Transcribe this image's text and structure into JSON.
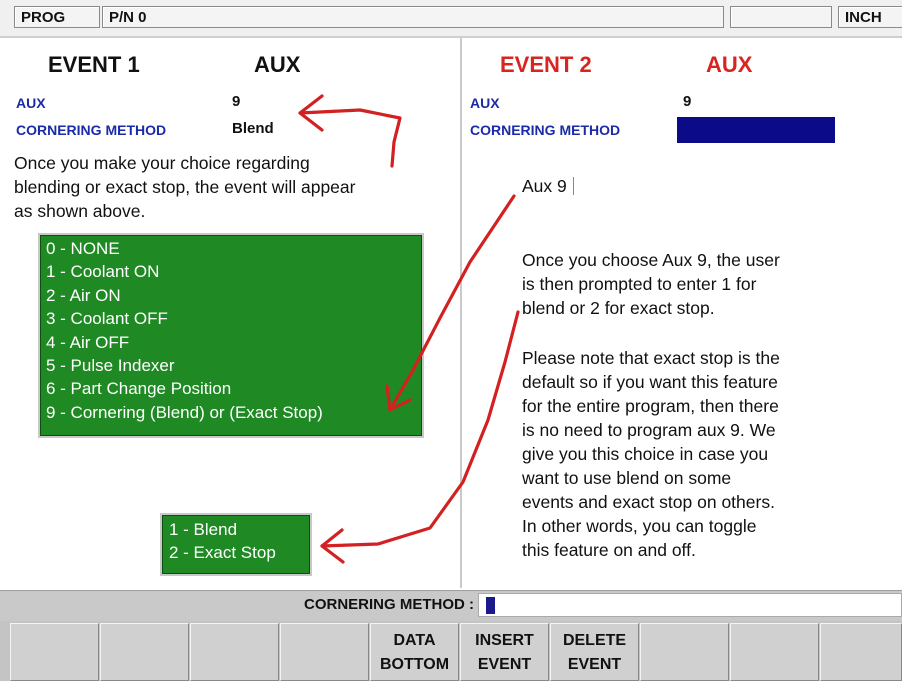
{
  "topbar": {
    "mode": "PROG",
    "part_number": "P/N 0",
    "units": "INCH"
  },
  "left_panel": {
    "event_title": "EVENT 1",
    "event_type": "AUX",
    "fields": [
      {
        "label": "AUX",
        "value": "9"
      },
      {
        "label": "CORNERING METHOD",
        "value": "Blend"
      }
    ],
    "note": [
      "Once you make your choice regarding",
      "blending or exact stop, the event will appear",
      "as shown above."
    ],
    "aux_options": [
      "0 - NONE",
      "1 - Coolant ON",
      "2 - Air ON",
      "3 - Coolant OFF",
      "4 - Air OFF",
      "5 - Pulse Indexer",
      "6 - Part Change Position",
      "9 - Cornering (Blend) or (Exact Stop)"
    ],
    "cornering_options": [
      "1 - Blend",
      "2 - Exact Stop"
    ]
  },
  "right_panel": {
    "event_title": "EVENT 2",
    "event_type": "AUX",
    "fields": [
      {
        "label": "AUX",
        "value": "9"
      },
      {
        "label": "CORNERING METHOD",
        "value": ""
      }
    ],
    "typed_entry": "Aux 9",
    "note1": [
      "Once you choose Aux 9, the user",
      "is then prompted to enter 1 for",
      "blend or 2 for exact stop."
    ],
    "note2": [
      "Please note that exact stop is the",
      "default so if you want this feature",
      "for the entire program, then there",
      "is no need to program aux 9.  We",
      "give you this choice in case you",
      "want to use blend on some",
      "events and exact stop on others.",
      "In other words, you can toggle",
      "this feature on and off."
    ]
  },
  "input_line": {
    "label": "CORNERING METHOD :"
  },
  "function_keys": [
    {
      "line1": "",
      "line2": ""
    },
    {
      "line1": "",
      "line2": ""
    },
    {
      "line1": "",
      "line2": ""
    },
    {
      "line1": "",
      "line2": ""
    },
    {
      "line1": "DATA",
      "line2": "BOTTOM"
    },
    {
      "line1": "INSERT",
      "line2": "EVENT"
    },
    {
      "line1": "DELETE",
      "line2": "EVENT"
    },
    {
      "line1": "",
      "line2": ""
    },
    {
      "line1": "",
      "line2": ""
    },
    {
      "line1": "",
      "line2": ""
    }
  ],
  "colors": {
    "event2_red": "#d9241f",
    "label_blue": "#1a2aa8",
    "menu_green": "#1f8a24",
    "field_highlight": "#0b0b8a",
    "annotation_arrow": "#d32020"
  }
}
